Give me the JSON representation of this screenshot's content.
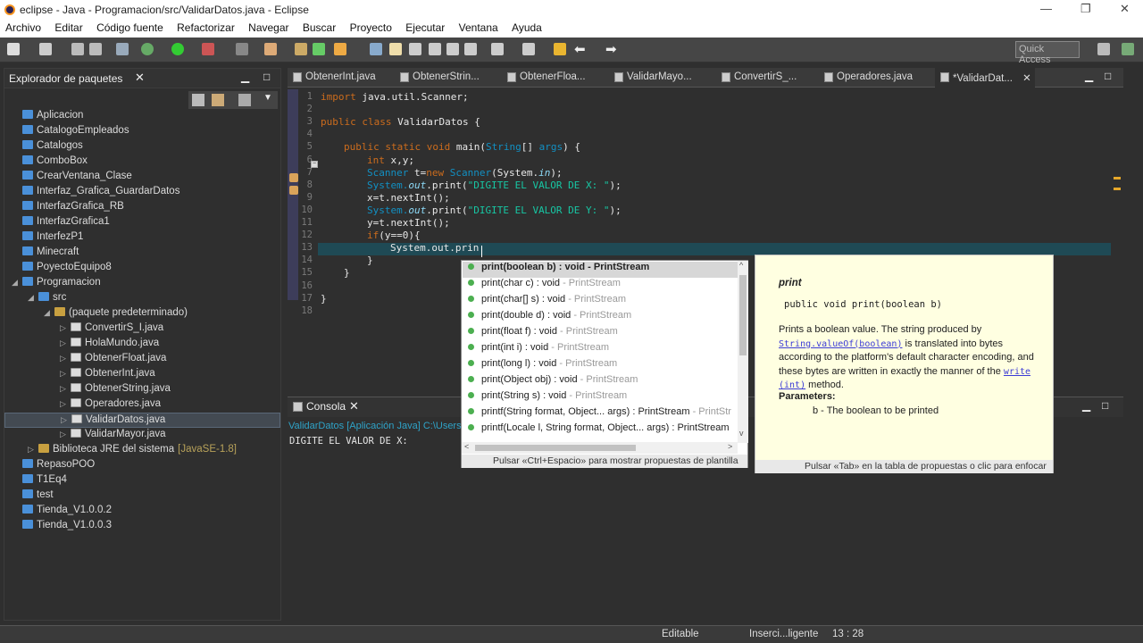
{
  "window": {
    "title": "eclipse - Java - Programacion/src/ValidarDatos.java - Eclipse",
    "minimize": "—",
    "maximize": "❐",
    "close": "✕"
  },
  "menu": [
    "Archivo",
    "Editar",
    "Código fuente",
    "Refactorizar",
    "Navegar",
    "Buscar",
    "Proyecto",
    "Ejecutar",
    "Ventana",
    "Ayuda"
  ],
  "toolbar": {
    "quick_access": "Quick Access"
  },
  "package_explorer": {
    "title": "Explorador de paquetes",
    "items": [
      {
        "label": "Aplicacion",
        "type": "project",
        "indent": 0,
        "arrow": ""
      },
      {
        "label": "CatalogoEmpleados",
        "type": "project",
        "indent": 0,
        "arrow": ""
      },
      {
        "label": "Catalogos",
        "type": "project",
        "indent": 0,
        "arrow": ""
      },
      {
        "label": "ComboBox",
        "type": "project",
        "indent": 0,
        "arrow": ""
      },
      {
        "label": "CrearVentana_Clase",
        "type": "project",
        "indent": 0,
        "arrow": ""
      },
      {
        "label": "Interfaz_Grafica_GuardarDatos",
        "type": "project",
        "indent": 0,
        "arrow": ""
      },
      {
        "label": "InterfazGrafica_RB",
        "type": "project",
        "indent": 0,
        "arrow": ""
      },
      {
        "label": "InterfazGrafica1",
        "type": "project",
        "indent": 0,
        "arrow": ""
      },
      {
        "label": "InterfezP1",
        "type": "project",
        "indent": 0,
        "arrow": ""
      },
      {
        "label": "Minecraft",
        "type": "project",
        "indent": 0,
        "arrow": ""
      },
      {
        "label": "PoyectoEquipo8",
        "type": "project",
        "indent": 0,
        "arrow": ""
      },
      {
        "label": "Programacion",
        "type": "project",
        "indent": 0,
        "arrow": "◢"
      },
      {
        "label": "src",
        "type": "folder",
        "indent": 1,
        "arrow": "◢"
      },
      {
        "label": "(paquete predeterminado)",
        "type": "package",
        "indent": 2,
        "arrow": "◢"
      },
      {
        "label": "ConvertirS_I.java",
        "type": "file",
        "indent": 3,
        "arrow": "▷"
      },
      {
        "label": "HolaMundo.java",
        "type": "file",
        "indent": 3,
        "arrow": "▷"
      },
      {
        "label": "ObtenerFloat.java",
        "type": "file",
        "indent": 3,
        "arrow": "▷"
      },
      {
        "label": "ObtenerInt.java",
        "type": "file",
        "indent": 3,
        "arrow": "▷"
      },
      {
        "label": "ObtenerString.java",
        "type": "file",
        "indent": 3,
        "arrow": "▷"
      },
      {
        "label": "Operadores.java",
        "type": "file",
        "indent": 3,
        "arrow": "▷"
      },
      {
        "label": "ValidarDatos.java",
        "type": "file",
        "indent": 3,
        "arrow": "▷",
        "selected": true
      },
      {
        "label": "ValidarMayor.java",
        "type": "file",
        "indent": 3,
        "arrow": "▷"
      },
      {
        "label": "Biblioteca JRE del sistema",
        "suffix": "[JavaSE-1.8]",
        "type": "lib",
        "indent": 1,
        "arrow": "▷"
      },
      {
        "label": "RepasoPOO",
        "type": "project",
        "indent": 0,
        "arrow": ""
      },
      {
        "label": "T1Eq4",
        "type": "project",
        "indent": 0,
        "arrow": ""
      },
      {
        "label": "test",
        "type": "project",
        "indent": 0,
        "arrow": ""
      },
      {
        "label": "Tienda_V1.0.0.2",
        "type": "project",
        "indent": 0,
        "arrow": ""
      },
      {
        "label": "Tienda_V1.0.0.3",
        "type": "project",
        "indent": 0,
        "arrow": ""
      }
    ]
  },
  "editor_tabs": [
    "ObtenerInt.java",
    "ObtenerStrin...",
    "ObtenerFloa...",
    "ValidarMayo...",
    "ConvertirS_...",
    "Operadores.java",
    "*ValidarDat..."
  ],
  "code": {
    "line_numbers": [
      "1",
      "2",
      "3",
      "4",
      "5",
      "6",
      "7",
      "8",
      "9",
      "10",
      "11",
      "12",
      "13",
      "14",
      "15",
      "16",
      "17",
      "18"
    ],
    "l1_a": "import",
    "l1_b": " java.util.Scanner;",
    "l3_a": "public class",
    "l3_b": " ValidarDatos {",
    "l5_a": "public static void",
    "l5_b": " main(",
    "l5_c": "String",
    "l5_d": "[] ",
    "l5_e": "args",
    ") {": "",
    "l5_f": ") {",
    "l6_a": "int",
    "l6_b": " x,y;",
    "l7_a": "Scanner",
    "l7_b": " t=",
    "l7_c": "new",
    "l7_d": " ",
    "l7_e": "Scanner",
    "l7_f": "(System.",
    "l7_g": "in",
    "l7_h": ");",
    "l8_a": "System.",
    "l8_b": "out",
    "l8_c": ".print(",
    "l8_d": "\"DIGITE EL VALOR DE X: \"",
    "l8_e": ");",
    "l9": "x=t.nextInt();",
    "l10_a": "System.",
    "l10_b": "out",
    "l10_c": ".print(",
    "l10_d": "\"DIGITE EL VALOR DE Y: \"",
    "l10_e": ");",
    "l11": "y=t.nextInt();",
    "l12_a": "if",
    "l12_b": "(y==0){",
    "l13": "System.out.prin",
    "l14": "}",
    "l15": "}",
    "l17": "}"
  },
  "console": {
    "tab": "Consola",
    "launch": "ValidarDatos [Aplicación Java] C:\\Users\\",
    "output": "DIGITE EL VALOR DE X:"
  },
  "autocomplete": {
    "items": [
      {
        "sig": "print(boolean b) : void",
        "owner": " - PrintStream",
        "selected": true
      },
      {
        "sig": "print(char c) : void",
        "owner": " - PrintStream"
      },
      {
        "sig": "print(char[] s) : void",
        "owner": " - PrintStream"
      },
      {
        "sig": "print(double d) : void",
        "owner": " - PrintStream"
      },
      {
        "sig": "print(float f) : void",
        "owner": " - PrintStream"
      },
      {
        "sig": "print(int i) : void",
        "owner": " - PrintStream"
      },
      {
        "sig": "print(long l) : void",
        "owner": " - PrintStream"
      },
      {
        "sig": "print(Object obj) : void",
        "owner": " - PrintStream"
      },
      {
        "sig": "print(String s) : void",
        "owner": " - PrintStream"
      },
      {
        "sig": "printf(String format, Object... args) : PrintStream",
        "owner": " - PrintStr"
      },
      {
        "sig": "printf(Locale l, String format, Object... args) : PrintStream",
        "owner": ""
      }
    ],
    "footer": "Pulsar «Ctrl+Espacio» para mostrar propuestas de plantilla"
  },
  "javadoc": {
    "name": "print",
    "signature": "public void print(boolean b)",
    "desc_1": "Prints a boolean value. The string produced by",
    "link_1": "String.valueOf(boolean)",
    "desc_2": " is translated into bytes according to the platform's default character encoding, and these bytes are written in exactly the manner of the ",
    "link_2a": "write",
    "link_2b": "(int)",
    "desc_3": " method.",
    "params_label": "Parameters:",
    "param": "b - The boolean to be printed",
    "footer": "Pulsar «Tab» en la tabla de propuestas o clic para enfocar"
  },
  "status": {
    "mode": "Editable",
    "insert": "Inserci...ligente",
    "pos": "13 : 28"
  },
  "colors": {
    "keyword": "#cc6c1d",
    "type": "#1290c3",
    "string": "#17c6a3",
    "field": "#8ddaf8",
    "background": "#2f2f2f"
  }
}
